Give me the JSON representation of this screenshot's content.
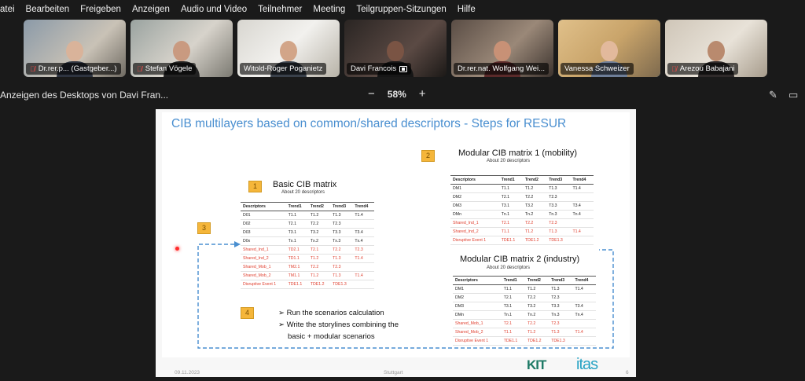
{
  "menu": [
    "atei",
    "Bearbeiten",
    "Freigeben",
    "Anzeigen",
    "Audio und Video",
    "Teilnehmer",
    "Meeting",
    "Teilgruppen-Sitzungen",
    "Hilfe"
  ],
  "participants": [
    {
      "name": "Dr.rer.p... (Gastgeber...)",
      "muted": true
    },
    {
      "name": "Stefan Vögele",
      "muted": true
    },
    {
      "name": "Witold-Roger Poganietz",
      "muted": false
    },
    {
      "name": "Davi Francois",
      "muted": false,
      "sharing": true
    },
    {
      "name": "Dr.rer.nat. Wolfgang Wei...",
      "muted": false
    },
    {
      "name": "Vanessa Schweizer",
      "muted": false,
      "active": true
    },
    {
      "name": "Arezou Babajani",
      "muted": true
    }
  ],
  "share": {
    "title": "Anzeigen des Desktops von Davi Fran...",
    "zoom_minus": "−",
    "zoom": "58%",
    "zoom_plus": "+"
  },
  "slide": {
    "title": "CIB multilayers based on common/shared descriptors - Steps for RESUR",
    "basic": {
      "num": "1",
      "title": "Basic CIB matrix",
      "note": "About 20 descriptors"
    },
    "m1": {
      "num": "2",
      "title": "Modular CIB matrix 1 (mobility)",
      "note": "About 20 descriptors"
    },
    "m2": {
      "title": "Modular CIB matrix 2 (industry)",
      "note": "About 20 descriptors"
    },
    "step3": "3",
    "step4": "4",
    "bullet1": "Run the scenarios calculation",
    "bullet2": "Write the storylines combining the",
    "bullet2b": "basic + modular scenarios",
    "footer_date": "09.11.2023",
    "footer_place": "Stuttgart",
    "page": "6",
    "logo1": "KIT",
    "logo2": "itas"
  },
  "tables": {
    "headers": [
      "Descriptors",
      "Trend1",
      "Trend2",
      "Trend3",
      "Trend4"
    ],
    "basic": [
      [
        "D01",
        "T1.1",
        "T1.2",
        "T1.3",
        "T1.4",
        false
      ],
      [
        "D02",
        "T2.1",
        "T2.2",
        "T2.3",
        "",
        false
      ],
      [
        "D03",
        "T3.1",
        "T3.2",
        "T3.3",
        "T3.4",
        false
      ],
      [
        "D0x",
        "Tx.1",
        "Tx.2",
        "Tx.3",
        "Tx.4",
        false
      ],
      [
        "Shared_Ind_1",
        "TD2.1",
        "T2.1",
        "T2.2",
        "T2.3",
        true
      ],
      [
        "Shared_Ind_2",
        "TD1.1",
        "T1.2",
        "T1.3",
        "T1.4",
        true
      ],
      [
        "Shared_Mob_1",
        "TM2.1",
        "T2.2",
        "T2.3",
        "",
        true
      ],
      [
        "Shared_Mob_2",
        "TM1.1",
        "T1.2",
        "T1.3",
        "T1.4",
        true
      ],
      [
        "Disruptive Event 1",
        "TDE1.1",
        "TDE1.2",
        "TDE1.3",
        "",
        true
      ]
    ],
    "m1": [
      [
        "DM1",
        "T1.1",
        "T1.2",
        "T1.3",
        "T1.4",
        false
      ],
      [
        "DM2",
        "T2.1",
        "T2.2",
        "T2.3",
        "",
        false
      ],
      [
        "DM3",
        "T3.1",
        "T3.2",
        "T3.3",
        "T3.4",
        false
      ],
      [
        "DMn",
        "Tn.1",
        "Tn.2",
        "Tn.3",
        "Tn.4",
        false
      ],
      [
        "Shared_Ind_1",
        "T2.1",
        "T2.2",
        "T2.3",
        "",
        true
      ],
      [
        "Shared_Ind_2",
        "T1.1",
        "T1.2",
        "T1.3",
        "T1.4",
        true
      ],
      [
        "Disruptive Event 1",
        "TDE1.1",
        "TDE1.2",
        "TDE1.3",
        "",
        true
      ]
    ],
    "m2": [
      [
        "DM1",
        "T1.1",
        "T1.2",
        "T1.3",
        "T1.4",
        false
      ],
      [
        "DM2",
        "T2.1",
        "T2.2",
        "T2.3",
        "",
        false
      ],
      [
        "DM3",
        "T3.1",
        "T3.2",
        "T3.3",
        "T3.4",
        false
      ],
      [
        "DMn",
        "Tn.1",
        "Tn.2",
        "Tn.3",
        "Tn.4",
        false
      ],
      [
        "Shared_Mob_1",
        "T2.1",
        "T2.2",
        "T2.3",
        "",
        true
      ],
      [
        "Shared_Mob_2",
        "T1.1",
        "T1.2",
        "T1.3",
        "T1.4",
        true
      ],
      [
        "Disruptive Event 1",
        "TDE1.1",
        "TDE1.2",
        "TDE1.3",
        "",
        true
      ]
    ]
  }
}
